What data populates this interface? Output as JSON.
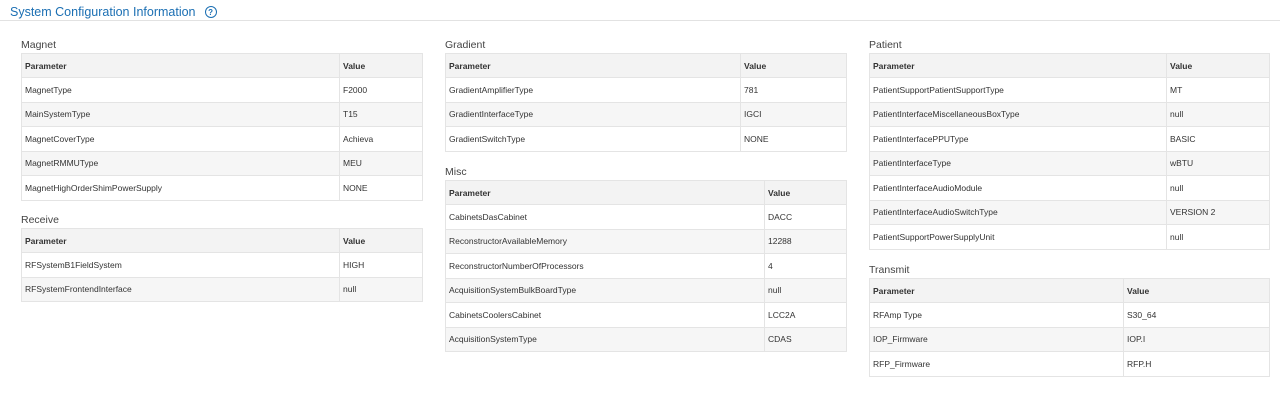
{
  "page": {
    "title": "System Configuration Information",
    "help_icon": "question-circle-icon"
  },
  "headers": {
    "parameter": "Parameter",
    "value": "Value"
  },
  "sections": {
    "magnet": {
      "title": "Magnet",
      "rows": [
        {
          "param": "MagnetType",
          "value": "F2000"
        },
        {
          "param": "MainSystemType",
          "value": "T15"
        },
        {
          "param": "MagnetCoverType",
          "value": "Achieva"
        },
        {
          "param": "MagnetRMMUType",
          "value": "MEU"
        },
        {
          "param": "MagnetHighOrderShimPowerSupply",
          "value": "NONE"
        }
      ]
    },
    "receive": {
      "title": "Receive",
      "rows": [
        {
          "param": "RFSystemB1FieldSystem",
          "value": "HIGH"
        },
        {
          "param": "RFSystemFrontendInterface",
          "value": "null"
        }
      ]
    },
    "gradient": {
      "title": "Gradient",
      "rows": [
        {
          "param": "GradientAmplifierType",
          "value": "781"
        },
        {
          "param": "GradientInterfaceType",
          "value": "IGCI"
        },
        {
          "param": "GradientSwitchType",
          "value": "NONE"
        }
      ]
    },
    "misc": {
      "title": "Misc",
      "rows": [
        {
          "param": "CabinetsDasCabinet",
          "value": "DACC"
        },
        {
          "param": "ReconstructorAvailableMemory",
          "value": "12288"
        },
        {
          "param": "ReconstructorNumberOfProcessors",
          "value": "4"
        },
        {
          "param": "AcquisitionSystemBulkBoardType",
          "value": "null"
        },
        {
          "param": "CabinetsCoolersCabinet",
          "value": "LCC2A"
        },
        {
          "param": "AcquisitionSystemType",
          "value": "CDAS"
        }
      ]
    },
    "patient": {
      "title": "Patient",
      "rows": [
        {
          "param": "PatientSupportPatientSupportType",
          "value": "MT"
        },
        {
          "param": "PatientInterfaceMiscellaneousBoxType",
          "value": "null"
        },
        {
          "param": "PatientInterfacePPUType",
          "value": "BASIC"
        },
        {
          "param": "PatientInterfaceType",
          "value": "wBTU"
        },
        {
          "param": "PatientInterfaceAudioModule",
          "value": "null"
        },
        {
          "param": "PatientInterfaceAudioSwitchType",
          "value": "VERSION 2"
        },
        {
          "param": "PatientSupportPowerSupplyUnit",
          "value": "null"
        }
      ]
    },
    "transmit": {
      "title": "Transmit",
      "rows": [
        {
          "param": "RFAmp Type",
          "value": "S30_64"
        },
        {
          "param": "IOP_Firmware",
          "value": "IOP.I"
        },
        {
          "param": "RFP_Firmware",
          "value": "RFP.H"
        }
      ]
    }
  }
}
